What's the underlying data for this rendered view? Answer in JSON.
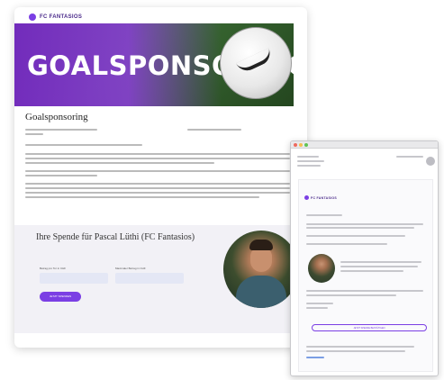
{
  "website": {
    "brand": "FC FANTASIOS",
    "banner_title": "GOALSPONSORING",
    "page_heading": "Goalsponsoring",
    "donation": {
      "title": "Ihre Spende für Pascal Lüthi (FC Fantasios)",
      "field1_label": "Betrag pro Tor in CHF",
      "field2_label": "Maximaler Betrag in CHF",
      "button_label": "JETZT SPENDEN"
    }
  },
  "email": {
    "brand": "FC FANTASIOS",
    "cta_label": "JETZT SPENDE BESTÄTIGEN"
  },
  "colors": {
    "accent": "#7b3fe4",
    "banner_purple": "#8c3cdc",
    "pitch_green": "#2d5a2a"
  },
  "icons": [
    "brand-logo-icon",
    "football-icon",
    "calendar-icon",
    "location-icon",
    "avatar-icon"
  ]
}
